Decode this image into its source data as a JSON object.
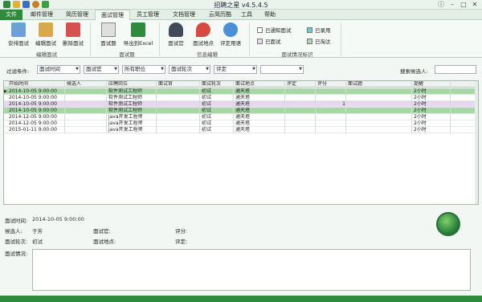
{
  "app": {
    "title": "招聘之星 v4.5.4.5"
  },
  "menu": {
    "tabs": [
      "文件",
      "邮件管理",
      "简历管理",
      "面试管理",
      "员工管理",
      "文档管理",
      "云简历酷",
      "工具",
      "帮助"
    ],
    "active": "面试管理"
  },
  "ribbon": {
    "groups": [
      {
        "label": "编辑面试",
        "buttons": [
          "安排面试",
          "编辑面试",
          "删除面试"
        ]
      },
      {
        "label": "面试题",
        "buttons": [
          "面试题",
          "导出到Excel"
        ]
      },
      {
        "label": "信息编辑",
        "buttons": [
          "面试官",
          "面试地点",
          "评定用语"
        ]
      },
      {
        "label": "面试情况标识"
      }
    ],
    "legend": [
      {
        "label": "已通知面试",
        "color": "#ffffff"
      },
      {
        "label": "已录用",
        "color": "#5fd3d3"
      },
      {
        "label": "已面试",
        "color": "#e5d8f0"
      },
      {
        "label": "已淘汰",
        "color": "#a8d8a8"
      }
    ]
  },
  "filter": {
    "label": "过滤条件:",
    "dropdowns": [
      "面试时间",
      "面试官",
      "所有职位",
      "面试轮次",
      "评定",
      ""
    ],
    "search_label": "搜索候选人:"
  },
  "grid": {
    "columns": [
      "开始时间",
      "候选人",
      "应聘岗位",
      "面试官",
      "面试轮次",
      "面试地点",
      "评定",
      "评分",
      "面试题",
      "提醒"
    ],
    "rows": [
      {
        "status": "selected",
        "cells": [
          "2014-10-05 9:00:00",
          "",
          "软件测试工程师",
          "",
          "初试",
          "通天塔",
          "",
          "",
          "",
          "2小时"
        ]
      },
      {
        "status": "normal",
        "cells": [
          "2014-10-05 9:00:00",
          "",
          "软件测试工程师",
          "",
          "初试",
          "通天塔",
          "",
          "",
          "",
          "2小时"
        ]
      },
      {
        "status": "interviewed",
        "cells": [
          "2014-10-05 9:00:00",
          "",
          "软件测试工程师",
          "",
          "初试",
          "通天塔",
          "",
          "1",
          "",
          "2小时"
        ]
      },
      {
        "status": "rejected",
        "cells": [
          "2014-10-05 9:00:00",
          "",
          "软件测试工程师",
          "",
          "初试",
          "通天塔",
          "",
          "",
          "",
          "2小时"
        ]
      },
      {
        "status": "normal",
        "cells": [
          "2014-12-05 9:00:00",
          "",
          "java开发工程师",
          "",
          "初试",
          "通天塔",
          "",
          "",
          "",
          "2小时"
        ]
      },
      {
        "status": "normal",
        "cells": [
          "2014-12-05 9:00:00",
          "",
          "java开发工程师",
          "",
          "初试",
          "通天塔",
          "",
          "",
          "",
          "2小时"
        ]
      },
      {
        "status": "normal",
        "cells": [
          "2015-01-11 9:00:00",
          "",
          "java开发工程师",
          "",
          "初试",
          "通天塔",
          "",
          "",
          "",
          "2小时"
        ]
      }
    ]
  },
  "detail": {
    "time_label": "面试时间:",
    "time_value": "2014-10-05 9:00:00",
    "candidate_label": "候选人:",
    "candidate_value": "于芳",
    "interviewer_label": "面试官:",
    "score_label": "评分:",
    "round_label": "面试轮次:",
    "round_value": "初试",
    "place_label": "面试地点:",
    "rating_label": "评定:",
    "notes_label": "面试情况:"
  }
}
